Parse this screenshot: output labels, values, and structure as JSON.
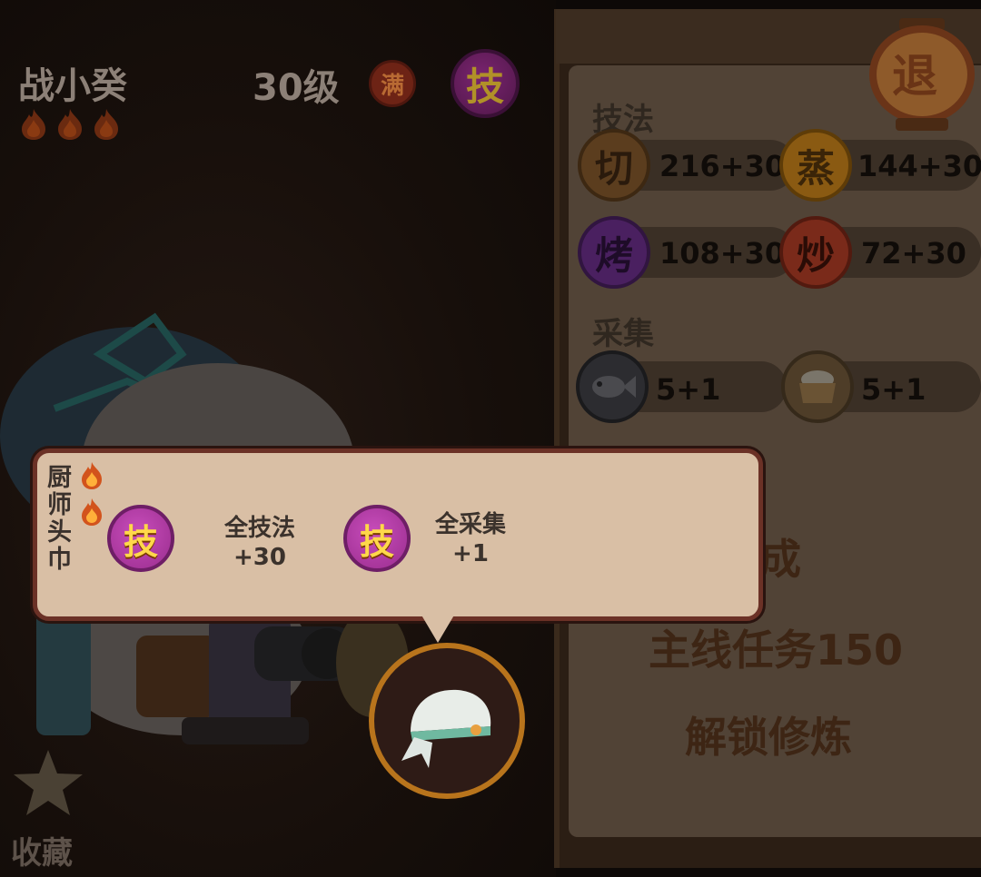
{
  "character": {
    "name": "战小癸",
    "level": "30级",
    "full_badge": "满",
    "skill_badge": "技",
    "flames": 3
  },
  "favorite": {
    "label": "收藏"
  },
  "quit_button": {
    "label": "退"
  },
  "stats": {
    "techniques_label": "技法",
    "techniques": [
      {
        "icon": "切",
        "value": "216+30",
        "color": "#5b3d1e"
      },
      {
        "icon": "蒸",
        "value": "144+30",
        "color": "#8a5a12"
      },
      {
        "icon": "烤",
        "value": "108+30",
        "color": "#4a2060"
      },
      {
        "icon": "炒",
        "value": "72+30",
        "color": "#7a2a1a"
      }
    ],
    "gather_label": "采集",
    "gathering": [
      {
        "icon": "fish-icon",
        "value": "5+1"
      },
      {
        "icon": "flour-bowl-icon",
        "value": "5+1"
      }
    ]
  },
  "task": {
    "line1": "完成",
    "line2": "主线任务150",
    "line3": "解锁修炼"
  },
  "popup": {
    "item_name_chars": [
      "厨",
      "师",
      "头",
      "巾"
    ],
    "effects": [
      {
        "badge": "技",
        "line1": "全技法",
        "line2": "+30"
      },
      {
        "badge": "技",
        "line1": "全采集",
        "line2": "+1"
      }
    ]
  },
  "equipped_item": {
    "icon": "bandana-icon"
  },
  "colors": {
    "flame": "#d2531c",
    "skill_badge": "#b03ea4",
    "popup_bg": "#d9bfa5",
    "popup_border": "#6b3126",
    "equip_ring": "#b8741c"
  }
}
